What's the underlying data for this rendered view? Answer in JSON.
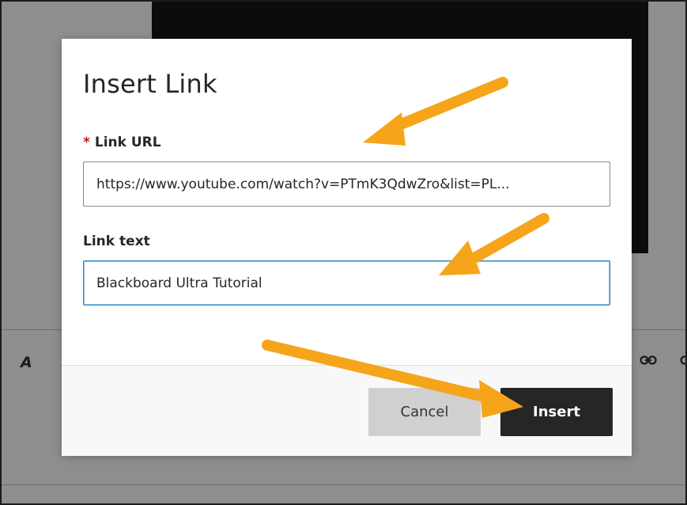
{
  "modal": {
    "title": "Insert Link",
    "required_marker": "*",
    "url_label": "Link URL",
    "url_value": "https://www.youtube.com/watch?v=PTmK3QdwZro&list=PL...",
    "text_label": "Link text",
    "text_value": "Blackboard Ultra Tutorial",
    "cancel_label": "Cancel",
    "insert_label": "Insert"
  },
  "toolbar": {
    "font_icon_glyph": "A",
    "icons": [
      "font-size-icon",
      "link-icon",
      "unlink-icon"
    ]
  },
  "annotations": {
    "arrow_color": "#f6a51a",
    "arrow_targets": [
      "link-url-field",
      "link-text-field",
      "insert-button"
    ]
  },
  "colors": {
    "required_star": "#c21a1a",
    "primary_button": "#262626",
    "secondary_button": "#d0d0d0",
    "focus_border": "#2d84c2"
  }
}
